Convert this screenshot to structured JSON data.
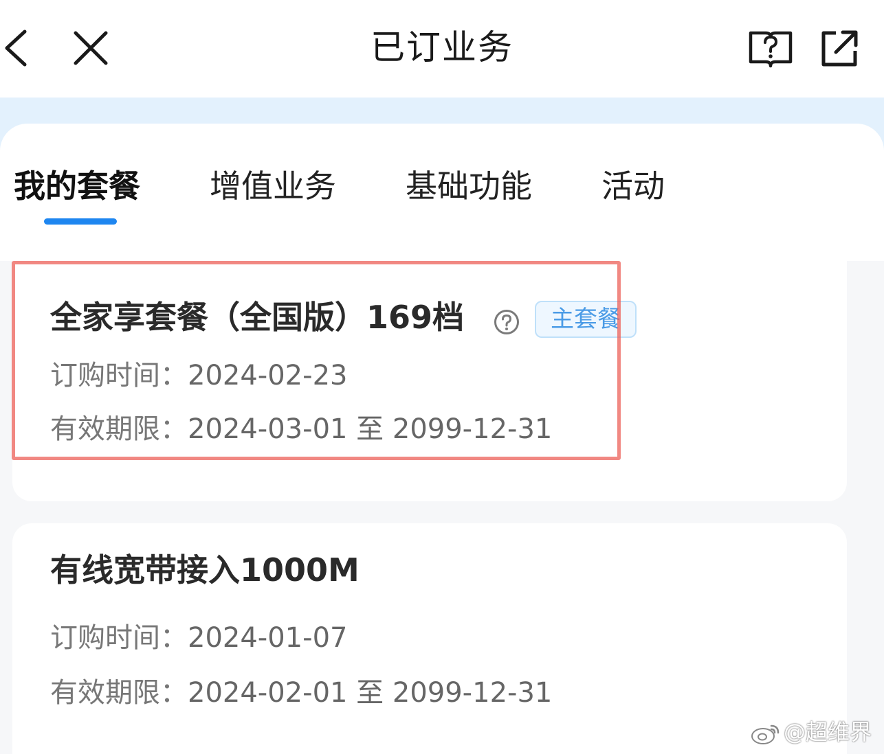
{
  "header": {
    "title": "已订业务",
    "back_icon": "chevron-left-icon",
    "close_icon": "close-icon",
    "help_icon": "help-book-icon",
    "share_icon": "external-share-icon"
  },
  "tabs": [
    {
      "label": "我的套餐",
      "active": true
    },
    {
      "label": "增值业务",
      "active": false
    },
    {
      "label": "基础功能",
      "active": false
    },
    {
      "label": "活动",
      "active": false
    }
  ],
  "cards": [
    {
      "title": "全家享套餐（全国版）169档",
      "badge": "主套餐",
      "order_label": "订购时间：",
      "order_date": "2024-02-23",
      "valid_label": "有效期限：",
      "valid_range": "2024-03-01 至 2099-12-31"
    },
    {
      "title": "有线宽带接入1000M",
      "order_label": "订购时间：",
      "order_date": "2024-01-07",
      "valid_label": "有效期限：",
      "valid_range": "2024-02-01 至 2099-12-31"
    }
  ],
  "watermark": "@超维界",
  "colors": {
    "accent": "#1e86f0",
    "band": "#e3f1fd",
    "highlight": "#ec6058",
    "badge_text": "#4a9be6"
  }
}
